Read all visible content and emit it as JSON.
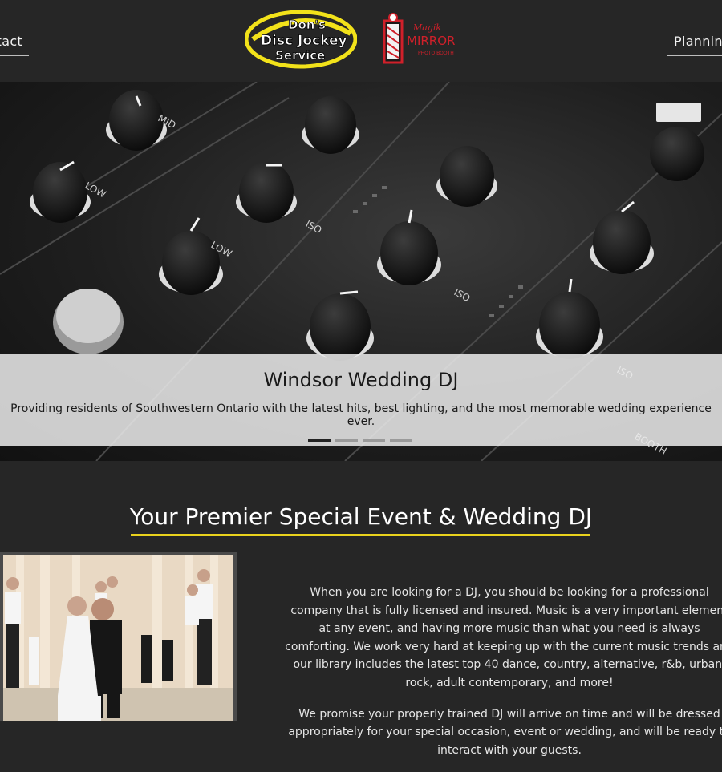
{
  "header": {
    "nav_left": "Contact",
    "nav_right": "Planning",
    "logo_dons": {
      "line1": "Don's",
      "line2": "Disc Jockey",
      "line3": "Service"
    },
    "logo_magik": {
      "line1": "Magik",
      "line2": "MIRROR",
      "line3": "PHOTO BOOTH"
    }
  },
  "hero": {
    "title": "Windsor Wedding DJ",
    "subtitle": "Providing residents of Southwestern Ontario with the latest hits, best lighting, and the most memorable wedding experience ever.",
    "slides": 4,
    "active_slide": 1
  },
  "section": {
    "heading": "Your Premier Special Event & Wedding DJ",
    "paragraph1": "When you are looking for a DJ, you should be looking for a professional company that is fully licensed and insured. Music is a very important element at any event, and having more music than what you need is always comforting. We work very hard at keeping up with the current music trends and our library includes the latest top 40 dance, country, alternative, r&b, urban, rock, adult contemporary, and more!",
    "paragraph2": "We promise your properly trained DJ will arrive on time and will be dressed appropriately for your special occasion, event or wedding, and will be ready to interact with your guests."
  },
  "colors": {
    "background": "#262626",
    "accent_underline": "#e9d21d",
    "logo_yellow": "#f2e21a",
    "logo_red": "#d0202a"
  },
  "icons": [
    "dj-mixer-hero-image",
    "wedding-couple-photo"
  ]
}
